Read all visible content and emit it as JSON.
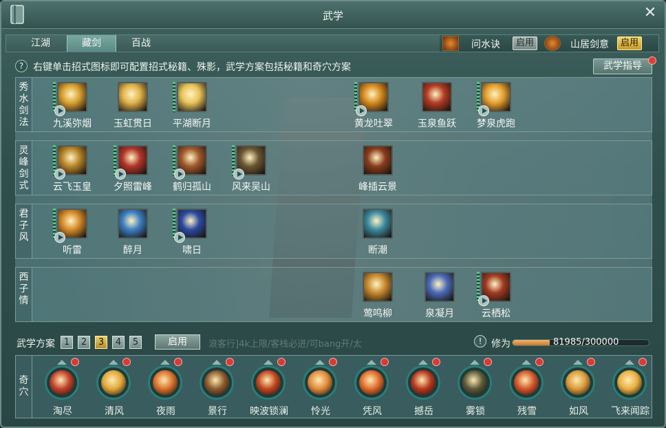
{
  "window": {
    "title": "武学"
  },
  "tabs": [
    "江湖",
    "藏剑",
    "百战"
  ],
  "buffs": [
    {
      "name": "问水诀",
      "button": "启用",
      "style": "grey"
    },
    {
      "name": "山居剑意",
      "button": "启用",
      "style": "gold"
    }
  ],
  "hint": "右键单击招式图标即可配置招式秘籍、殊影，武学方案包括秘籍和奇穴方案",
  "guide_button": "武学指导",
  "rows": [
    {
      "label": "秀水剑法",
      "skills": [
        {
          "name": "九溪弥烟",
          "color": "#d9a030",
          "bars": true,
          "play": true
        },
        {
          "name": "玉虹贯日",
          "color": "#e1b24a",
          "bars": false,
          "play": false
        },
        {
          "name": "平湖断月",
          "color": "#e9c45a",
          "bars": true,
          "play": false
        },
        {
          "name": "黄龙吐翠",
          "color": "#d68a1e",
          "bars": true,
          "play": true
        },
        {
          "name": "玉泉鱼跃",
          "color": "#b33b24",
          "bars": false,
          "play": false
        },
        {
          "name": "梦泉虎跑",
          "color": "#e6a030",
          "bars": true,
          "play": true
        }
      ]
    },
    {
      "label": "灵峰剑式",
      "skills": [
        {
          "name": "云飞玉皇",
          "color": "#b7852a",
          "bars": true,
          "play": true
        },
        {
          "name": "夕照雷峰",
          "color": "#b2342a",
          "bars": true,
          "play": true
        },
        {
          "name": "鹤归孤山",
          "color": "#a0582a",
          "bars": true,
          "play": true
        },
        {
          "name": "风来吴山",
          "color": "#6b5632",
          "bars": true,
          "play": true
        },
        {
          "name": "峰插云景",
          "color": "#8a3c1e",
          "bars": false,
          "play": false
        }
      ]
    },
    {
      "label": "君子风",
      "skills": [
        {
          "name": "听雷",
          "color": "#d68a2a",
          "bars": true,
          "play": true
        },
        {
          "name": "醉月",
          "color": "#3c7fc2",
          "bars": false,
          "play": false
        },
        {
          "name": "啸日",
          "color": "#2a4aa0",
          "bars": true,
          "play": true
        },
        {
          "name": "断潮",
          "color": "#3c8aa0",
          "bars": false,
          "play": false
        }
      ]
    },
    {
      "label": "西子情",
      "skills": [
        {
          "name": "莺鸣柳",
          "color": "#c98a30",
          "bars": false,
          "play": false
        },
        {
          "name": "泉凝月",
          "color": "#4a6ab8",
          "bars": false,
          "play": false
        },
        {
          "name": "云栖松",
          "color": "#a03a22",
          "bars": true,
          "play": true
        }
      ]
    }
  ],
  "plan": {
    "label": "武学方案",
    "numbers": [
      "1",
      "2",
      "3",
      "4",
      "5"
    ],
    "selected": 2,
    "button": "启用",
    "chat_ghost": "浪客行]4k上限/客栈必进/可bang开/太"
  },
  "xiuwei": {
    "label": "修为",
    "current": 81985,
    "max": 300000,
    "text": "81985/300000"
  },
  "qixue": {
    "label": "奇穴",
    "items": [
      {
        "name": "淘尽",
        "color": "#c0402a"
      },
      {
        "name": "清风",
        "color": "#e0a83a"
      },
      {
        "name": "夜雨",
        "color": "#d8702a"
      },
      {
        "name": "景行",
        "color": "#8a5a2e"
      },
      {
        "name": "映波锁澜",
        "color": "#c0451e"
      },
      {
        "name": "怜光",
        "color": "#e08a3a"
      },
      {
        "name": "凭风",
        "color": "#e06a2a"
      },
      {
        "name": "撼岳",
        "color": "#b8361e"
      },
      {
        "name": "雾锁",
        "color": "#5a5a3a"
      },
      {
        "name": "残雪",
        "color": "#d2542a"
      },
      {
        "name": "如风",
        "color": "#d89a3a"
      },
      {
        "name": "飞来闻踪",
        "color": "#e8b040"
      }
    ]
  }
}
